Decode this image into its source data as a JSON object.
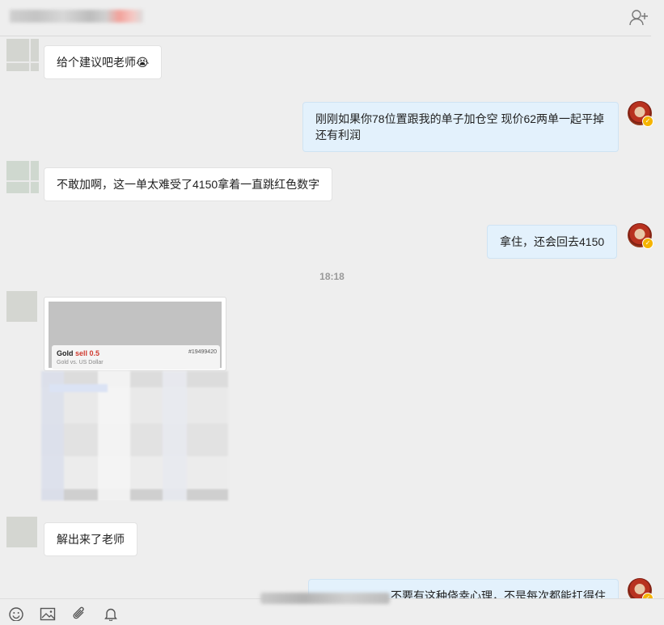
{
  "header": {
    "add_contact_icon": "add-contact-icon"
  },
  "messages": [
    {
      "side": "left",
      "text": "给个建议吧老师😭"
    },
    {
      "side": "right",
      "text": "刚刚如果你78位置跟我的单子加仓空 现价62两单一起平掉还有利润"
    },
    {
      "side": "left",
      "text": "不敢加啊，这一单太难受了4150拿着一直跳红色数字"
    },
    {
      "side": "right",
      "text": "拿住，还会回去4150"
    },
    {
      "side": "left",
      "text": "解出来了老师"
    },
    {
      "side": "right",
      "text": "不要有这种侥幸心理，不是每次都能扛得住"
    }
  ],
  "timestamp": "18:18",
  "image_message": {
    "symbol": "Gold",
    "action": "sell 0.5",
    "description": "Gold vs. US Dollar",
    "order_id": "#19499420"
  },
  "toolbar": {
    "icons": [
      "emoji-icon",
      "image-icon",
      "attachment-icon",
      "bell-icon"
    ]
  },
  "colors": {
    "background": "#eeeeee",
    "left_bubble": "#ffffff",
    "right_bubble": "#e3f1fc",
    "sell_red": "#d03a2f"
  }
}
